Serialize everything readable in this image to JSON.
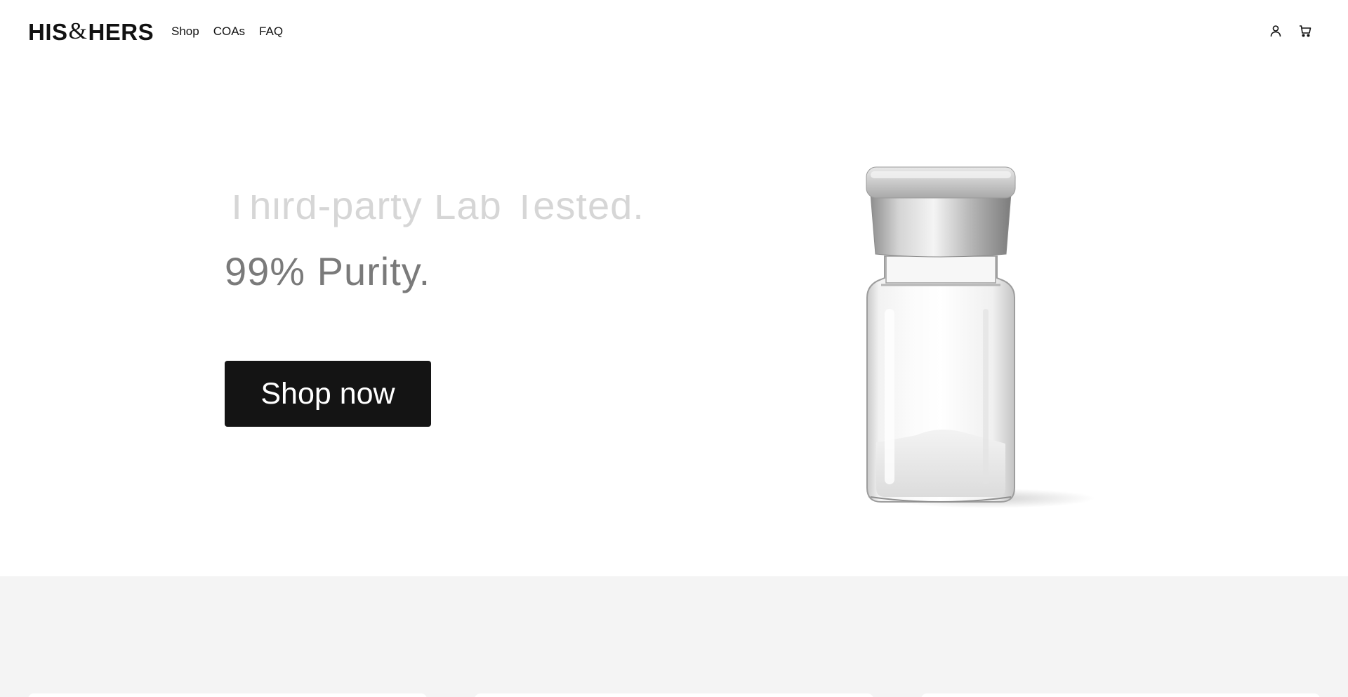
{
  "header": {
    "logo": {
      "left": "HIS",
      "amp": "&",
      "right": "HERS"
    },
    "nav": [
      {
        "label": "Shop"
      },
      {
        "label": "COAs"
      },
      {
        "label": "FAQ"
      }
    ],
    "icons": {
      "account": "user-icon",
      "cart": "cart-icon"
    }
  },
  "hero": {
    "line_faded": "Third-party Lab Tested.",
    "line_main": "99% Purity.",
    "cta_label": "Shop now",
    "image": "vial-with-white-powder"
  },
  "colors": {
    "background": "#ffffff",
    "text": "#111111",
    "headline": "#7a7a7a",
    "headline_faded": "#d6d6d6",
    "button_bg": "#141414",
    "button_text": "#ffffff",
    "section_bg": "#f4f4f4"
  }
}
